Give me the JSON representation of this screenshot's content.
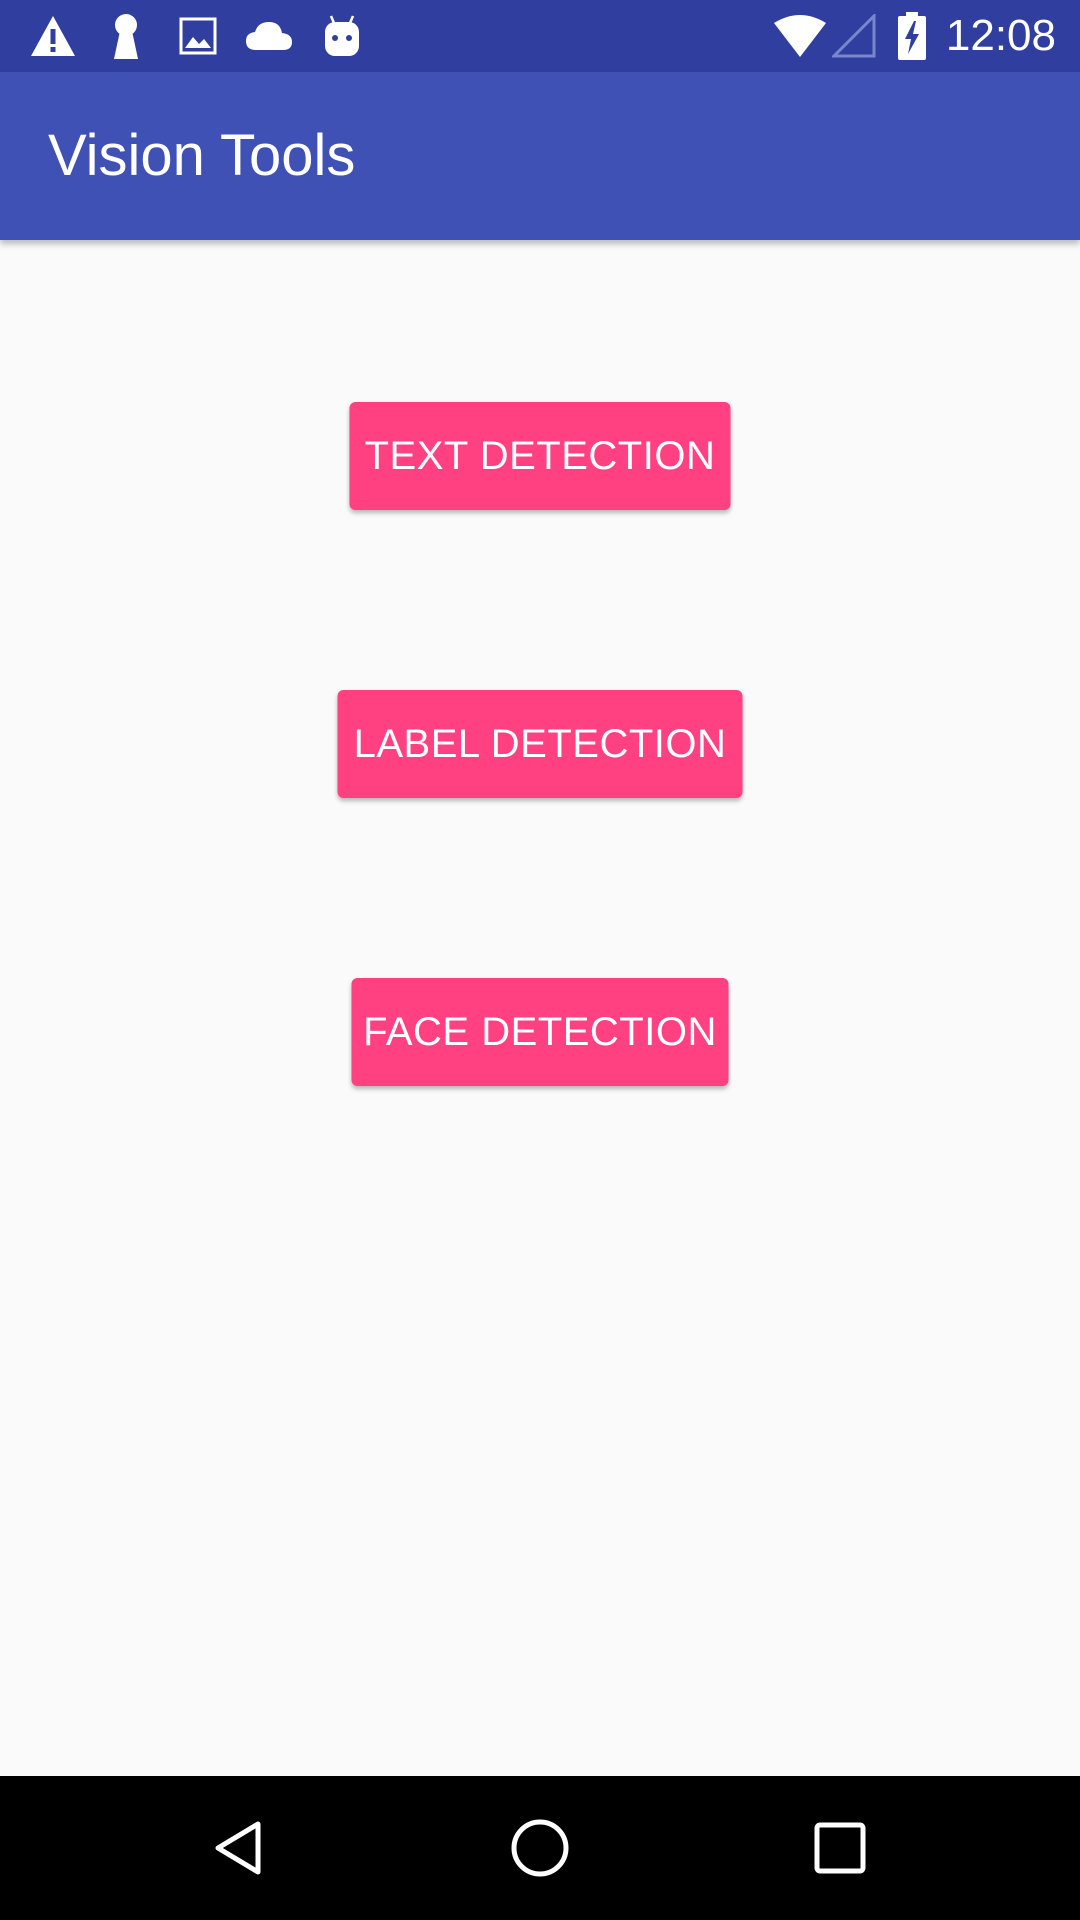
{
  "status_bar": {
    "time": "12:08",
    "icons": [
      "warning-icon",
      "keyhole-icon",
      "image-icon",
      "cloud-icon",
      "android-robot-icon",
      "wifi-icon",
      "cell-signal-icon",
      "battery-charging-icon"
    ]
  },
  "app_bar": {
    "title": "Vision Tools"
  },
  "buttons": {
    "text_detection": "TEXT DETECTION",
    "label_detection": "LABEL DETECTION",
    "face_detection": "FACE DETECTION"
  },
  "colors": {
    "status_bar": "#303f9f",
    "app_bar": "#3f51b5",
    "accent": "#ff4081",
    "background": "#fafafa",
    "nav_bar": "#000000"
  },
  "nav_bar": {
    "icons": [
      "back-icon",
      "home-icon",
      "recents-icon"
    ]
  }
}
